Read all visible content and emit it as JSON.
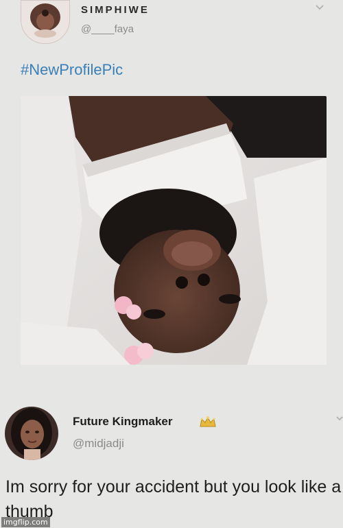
{
  "tweet1": {
    "display_name": "SIMPHIWE",
    "handle": "@____faya",
    "text": "#NewProfilePic",
    "menu_icon": "chevron-down-icon",
    "photo_description_icon": "profile-photo"
  },
  "tweet2": {
    "display_name": "Future Kingmaker",
    "name_emoji": "crown-icon",
    "handle": "@midjadji",
    "text": "Im sorry for your accident but you look like a thumb",
    "menu_icon": "chevron-down-icon"
  },
  "watermark": "imgflip.com",
  "colors": {
    "background": "#e6e6e4",
    "hashtag": "#3a7fb8",
    "handle": "#8a8a8a"
  }
}
